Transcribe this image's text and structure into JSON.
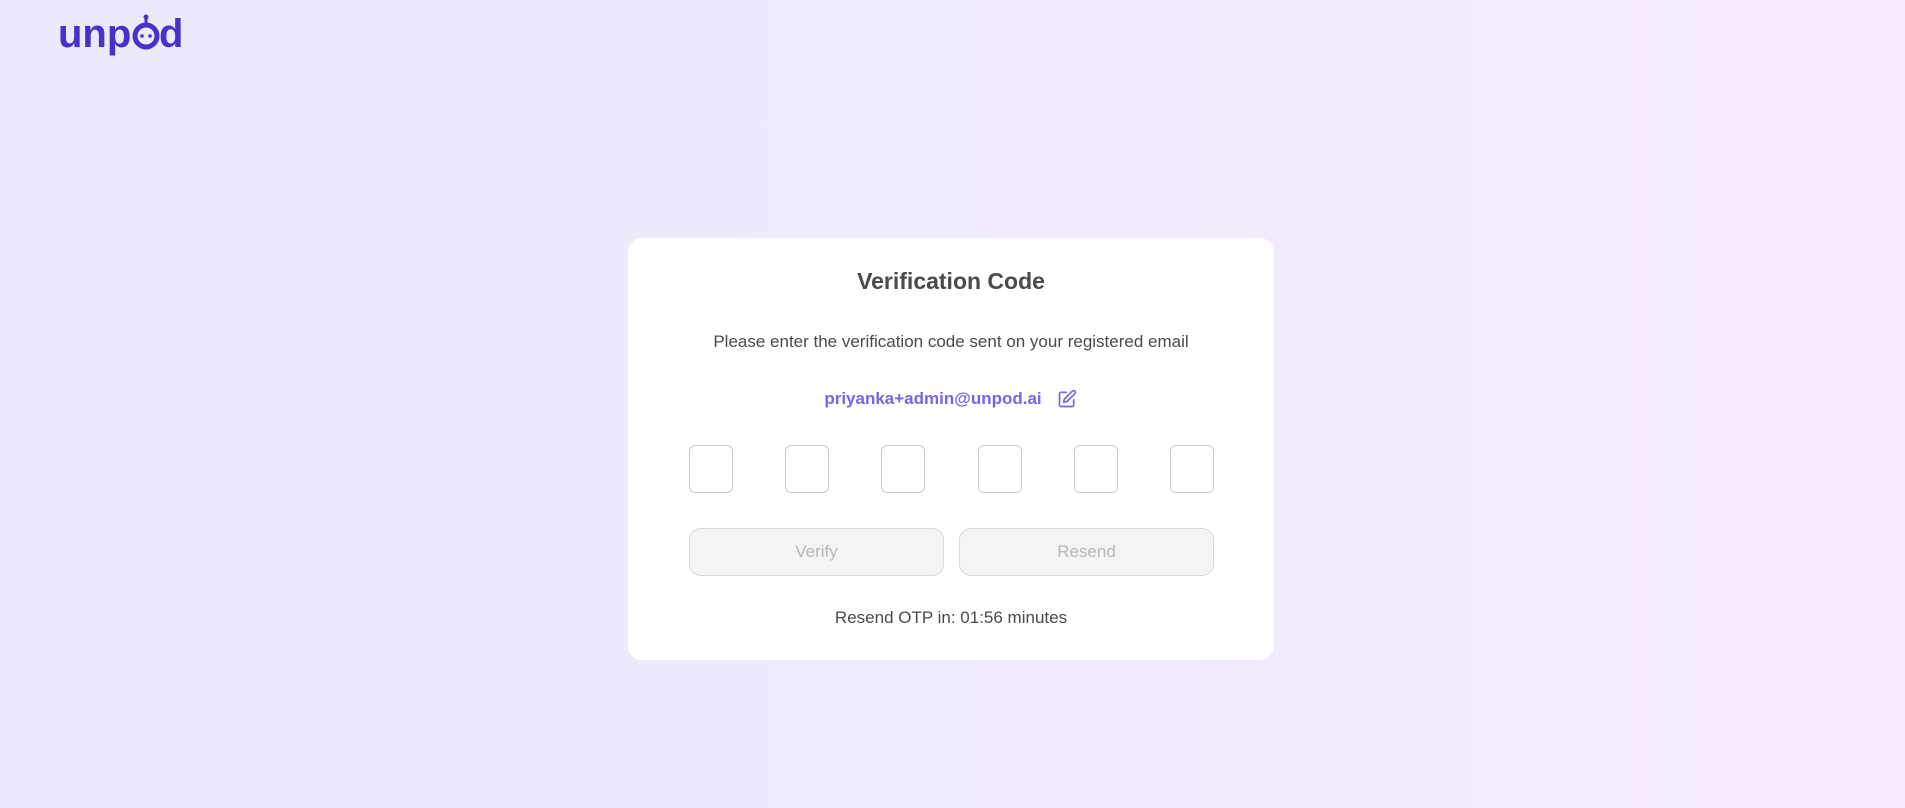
{
  "brand": {
    "logo_text": "unpod",
    "logo_color": "#4b2fc9"
  },
  "verification": {
    "title": "Verification Code",
    "subtitle": "Please enter the verification code sent on your registered email",
    "email": "priyanka+admin@unpod.ai",
    "edit_icon": "edit-icon",
    "otp_digits": [
      "",
      "",
      "",
      "",
      "",
      ""
    ],
    "verify_label": "Verify",
    "resend_label": "Resend",
    "timer_text": "Resend OTP in: 01:56 minutes"
  },
  "colors": {
    "accent": "#7a63e6",
    "text": "#4a4a4a",
    "disabled_text": "#b7b7b7",
    "disabled_bg": "#f4f4f4"
  }
}
